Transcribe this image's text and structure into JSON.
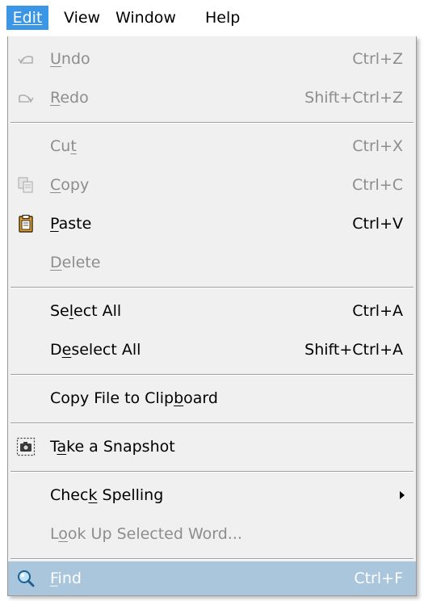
{
  "menubar": {
    "items": [
      {
        "label": "Edit",
        "active": true
      },
      {
        "label": "View"
      },
      {
        "label": "Window"
      },
      {
        "label": "Help"
      }
    ]
  },
  "menu": {
    "undo": {
      "pre": "",
      "accel": "U",
      "post": "ndo",
      "shortcut": "Ctrl+Z",
      "icon": "undo-icon",
      "enabled": false
    },
    "redo": {
      "pre": "",
      "accel": "R",
      "post": "edo",
      "shortcut": "Shift+Ctrl+Z",
      "icon": "redo-icon",
      "enabled": false
    },
    "cut": {
      "pre": "Cu",
      "accel": "t",
      "post": "",
      "shortcut": "Ctrl+X",
      "enabled": false
    },
    "copy": {
      "pre": "",
      "accel": "C",
      "post": "opy",
      "shortcut": "Ctrl+C",
      "icon": "copy-icon",
      "enabled": false
    },
    "paste": {
      "pre": "",
      "accel": "P",
      "post": "aste",
      "shortcut": "Ctrl+V",
      "icon": "paste-icon",
      "enabled": true
    },
    "delete": {
      "pre": "",
      "accel": "D",
      "post": "elete",
      "enabled": false
    },
    "select_all": {
      "pre": "Se",
      "accel": "l",
      "post": "ect All",
      "shortcut": "Ctrl+A",
      "enabled": true
    },
    "deselect_all": {
      "pre": "D",
      "accel": "e",
      "post": "select All",
      "shortcut": "Shift+Ctrl+A",
      "enabled": true
    },
    "copy_file": {
      "pre": "Copy File to Clip",
      "accel": "b",
      "post": "oard",
      "enabled": true
    },
    "snapshot": {
      "pre": "T",
      "accel": "a",
      "post": "ke a Snapshot",
      "icon": "camera-icon",
      "enabled": true
    },
    "check_spelling": {
      "pre": "Chec",
      "accel": "k",
      "post": " Spelling",
      "submenu": true,
      "enabled": true
    },
    "look_up": {
      "pre": "L",
      "accel": "o",
      "post": "ok Up Selected Word...",
      "enabled": false
    },
    "find": {
      "pre": "",
      "accel": "F",
      "post": "ind",
      "shortcut": "Ctrl+F",
      "icon": "find-icon",
      "enabled": true,
      "highlighted": true
    }
  },
  "colors": {
    "menubar_active": "#3b97e5",
    "menu_background": "#f0f0f0",
    "highlight": "#a9c6dd",
    "disabled_text": "#8d8d8d"
  }
}
